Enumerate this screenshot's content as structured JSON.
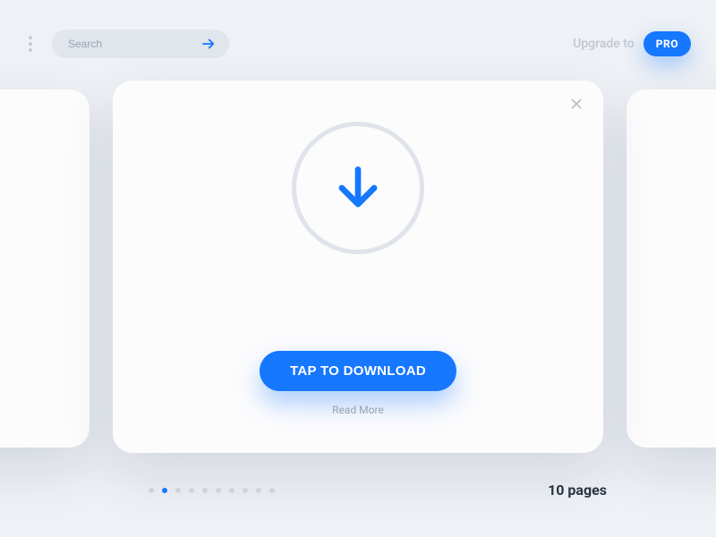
{
  "header": {
    "search_placeholder": "Search",
    "upgrade_label": "Upgrade to",
    "pro_label": "PRO"
  },
  "card": {
    "tap_label": "TAP TO DOWNLOAD",
    "read_more": "Read More"
  },
  "pager": {
    "active_index": 1,
    "total": 10,
    "count_label": "10 pages"
  },
  "colors": {
    "accent": "#1677ff"
  }
}
